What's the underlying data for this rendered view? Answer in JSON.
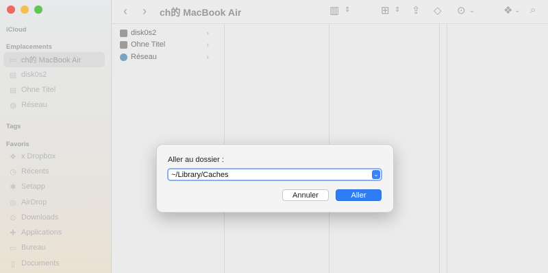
{
  "sidebar": {
    "sections": {
      "icloud": "iCloud",
      "emplacements": "Emplacements",
      "tags": "Tags",
      "favoris": "Favoris"
    },
    "locations": [
      {
        "label": "ch的 MacBook Air",
        "icon": "laptop-icon",
        "selected": true
      },
      {
        "label": "disk0s2",
        "icon": "disk-icon"
      },
      {
        "label": "Ohne Titel",
        "icon": "disk-icon"
      },
      {
        "label": "Réseau",
        "icon": "network-icon"
      }
    ],
    "favorites": [
      {
        "label": "x Dropbox",
        "icon": "dropbox-icon"
      },
      {
        "label": "Récents",
        "icon": "clock-icon"
      },
      {
        "label": "Setapp",
        "icon": "setapp-icon"
      },
      {
        "label": "AirDrop",
        "icon": "airdrop-icon"
      },
      {
        "label": "Downloads",
        "icon": "downloads-icon"
      },
      {
        "label": "Applications",
        "icon": "applications-icon"
      },
      {
        "label": "Bureau",
        "icon": "desktop-icon"
      },
      {
        "label": "Documents",
        "icon": "documents-icon"
      }
    ]
  },
  "toolbar": {
    "title": "ch的 MacBook Air"
  },
  "column1": {
    "items": [
      "disk0s2",
      "Ohne Titel",
      "Réseau"
    ]
  },
  "dialog": {
    "label": "Aller au dossier :",
    "path_value": "~/Library/Caches",
    "cancel_label": "Annuler",
    "go_label": "Aller"
  }
}
